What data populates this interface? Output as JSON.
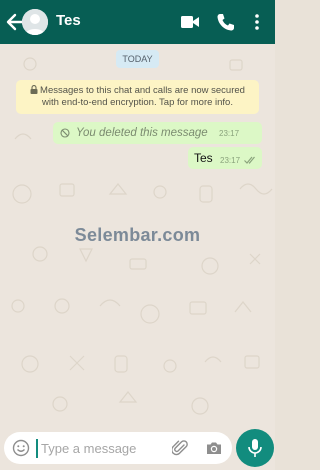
{
  "header": {
    "contact_name": "Tes",
    "background_color": "#075e54",
    "icons": [
      "back-arrow-icon",
      "avatar-icon",
      "video-call-icon",
      "phone-icon",
      "more-vert-icon"
    ]
  },
  "chat": {
    "date_chip": "TODAY",
    "encryption_notice": "Messages to this chat and calls are now secured with end-to-end encryption. Tap for more info.",
    "messages": [
      {
        "text": "You deleted this message",
        "time": "23:17",
        "deleted": true
      },
      {
        "text": "Tes",
        "time": "23:17",
        "status": "read"
      }
    ],
    "bubble_color": "#dcf8c6",
    "watermark": "Selembar.com"
  },
  "composer": {
    "placeholder": "Type a message",
    "value": "",
    "accent_color": "#128c7e",
    "icons": [
      "emoji-icon",
      "attach-icon",
      "camera-icon",
      "mic-icon"
    ]
  }
}
